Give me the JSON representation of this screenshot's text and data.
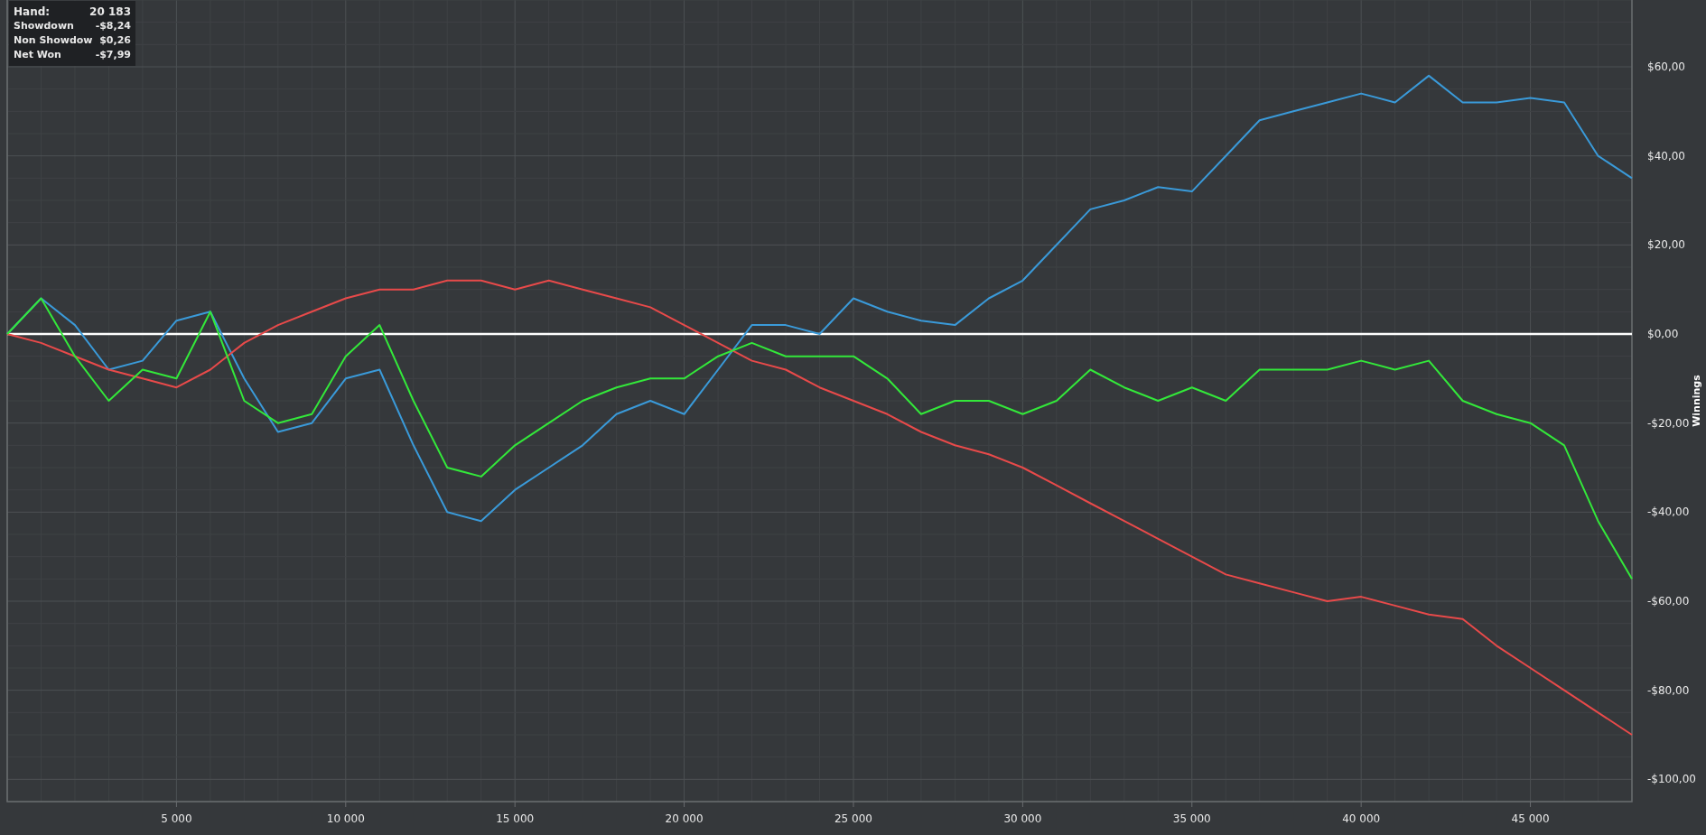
{
  "info_box": {
    "rows": [
      {
        "label": "Hand:",
        "value": "20 183"
      },
      {
        "label": "Showdown",
        "value": "-$8,24"
      },
      {
        "label": "Non Showdow",
        "value": "$0,26"
      },
      {
        "label": "Net Won",
        "value": "-$7,99"
      }
    ]
  },
  "chart": {
    "chart_data": {
      "type": "line",
      "ylabel": "Winnings",
      "x": [
        0,
        1000,
        2000,
        3000,
        4000,
        5000,
        6000,
        7000,
        8000,
        9000,
        10000,
        11000,
        12000,
        13000,
        14000,
        15000,
        16000,
        17000,
        18000,
        19000,
        20000,
        21000,
        22000,
        23000,
        24000,
        25000,
        26000,
        27000,
        28000,
        29000,
        30000,
        31000,
        32000,
        33000,
        34000,
        35000,
        36000,
        37000,
        38000,
        39000,
        40000,
        41000,
        42000,
        43000,
        44000,
        45000,
        46000,
        47000,
        48000
      ],
      "series": [
        {
          "color": "#3a9ad9",
          "values": [
            0,
            8,
            2,
            -8,
            -6,
            3,
            5,
            -10,
            -22,
            -20,
            -10,
            -8,
            -25,
            -40,
            -42,
            -35,
            -30,
            -25,
            -18,
            -15,
            -18,
            -8,
            2,
            2,
            0,
            8,
            5,
            3,
            2,
            8,
            12,
            20,
            28,
            30,
            33,
            32,
            40,
            48,
            50,
            52,
            54,
            52,
            58,
            52,
            52,
            53,
            52,
            40,
            35
          ]
        },
        {
          "color": "#e84a4a",
          "values": [
            0,
            -2,
            -5,
            -8,
            -10,
            -12,
            -8,
            -2,
            2,
            5,
            8,
            10,
            10,
            12,
            12,
            10,
            12,
            10,
            8,
            6,
            2,
            -2,
            -6,
            -8,
            -12,
            -15,
            -18,
            -22,
            -25,
            -27,
            -30,
            -34,
            -38,
            -42,
            -46,
            -50,
            -54,
            -56,
            -58,
            -60,
            -59,
            -61,
            -63,
            -64,
            -70,
            -75,
            -80,
            -85,
            -90
          ]
        },
        {
          "color": "#33e83a",
          "values": [
            0,
            8,
            -5,
            -15,
            -8,
            -10,
            5,
            -15,
            -20,
            -18,
            -5,
            2,
            -15,
            -30,
            -32,
            -25,
            -20,
            -15,
            -12,
            -10,
            -10,
            -5,
            -2,
            -5,
            -5,
            -5,
            -10,
            -18,
            -15,
            -15,
            -18,
            -15,
            -8,
            -12,
            -15,
            -12,
            -15,
            -8,
            -8,
            -8,
            -6,
            -8,
            -6,
            -15,
            -18,
            -20,
            -25,
            -42,
            -55
          ]
        }
      ],
      "grid": true,
      "xlim": [
        0,
        48000
      ],
      "ylim": [
        -105,
        75
      ],
      "xticks": [
        {
          "value": 5000,
          "label": "5 000"
        },
        {
          "value": 10000,
          "label": "10 000"
        },
        {
          "value": 15000,
          "label": "15 000"
        },
        {
          "value": 20000,
          "label": "20 000"
        },
        {
          "value": 25000,
          "label": "25 000"
        },
        {
          "value": 30000,
          "label": "30 000"
        },
        {
          "value": 35000,
          "label": "35 000"
        },
        {
          "value": 40000,
          "label": "40 000"
        },
        {
          "value": 45000,
          "label": "45 000"
        }
      ],
      "yticks": [
        {
          "value": 60,
          "label": "$60,00"
        },
        {
          "value": 40,
          "label": "$40,00"
        },
        {
          "value": 20,
          "label": "$20,00"
        },
        {
          "value": 0,
          "label": "$0,00"
        },
        {
          "value": -20,
          "label": "-$20,00"
        },
        {
          "value": -40,
          "label": "-$40,00"
        },
        {
          "value": -60,
          "label": "-$60,00"
        },
        {
          "value": -80,
          "label": "-$80,00"
        },
        {
          "value": -100,
          "label": "-$100,00"
        }
      ]
    }
  }
}
